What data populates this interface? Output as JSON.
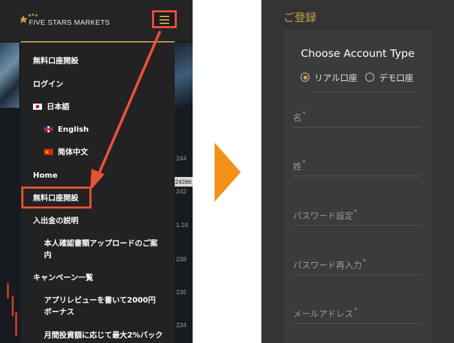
{
  "left": {
    "logo_text": "FIVE STARS MARKETS",
    "menu": [
      {
        "label": "無料口座開設"
      },
      {
        "label": "ログイン"
      },
      {
        "label": "日本語",
        "flag": "jp"
      },
      {
        "label": "English",
        "flag": "uk"
      },
      {
        "label": "简体中文",
        "flag": "cn"
      },
      {
        "label": "Home"
      },
      {
        "label": "無料口座開設",
        "highlighted": true
      },
      {
        "label": "入出金の説明"
      },
      {
        "label": "本人確認書類アップロードのご案内"
      },
      {
        "label": "キャンペーン一覧"
      },
      {
        "label": "アプリレビューを書いて2000円ボーナス"
      },
      {
        "label": "月間投資額に応じて最大2%バック"
      }
    ],
    "axis_labels": [
      "244",
      "24286",
      "242",
      "1.24",
      "238",
      "236",
      "234"
    ]
  },
  "right": {
    "page_title": "ご登録",
    "card_title": "Choose Account Type",
    "account_types": [
      {
        "label": "リアル口座",
        "selected": true
      },
      {
        "label": "デモ口座",
        "selected": false
      }
    ],
    "fields": [
      {
        "label": "名",
        "required_mark": "*"
      },
      {
        "label": "姓",
        "required_mark": "*"
      },
      {
        "label": "パスワード設定",
        "required_mark": "*"
      },
      {
        "label": "パスワード再入力",
        "required_mark": "*"
      },
      {
        "label": "メールアドレス",
        "required_mark": "*"
      }
    ]
  },
  "colors": {
    "accent_gold": "#c8a14a",
    "highlight_red": "#e8503a",
    "arrow_orange": "#f39019",
    "panel_dark": "#262626",
    "form_bg": "#333333",
    "card_bg": "#3b3b3b"
  },
  "icons": [
    "hamburger-menu-icon",
    "five-stars-logo-icon",
    "japan-flag-icon",
    "uk-flag-icon",
    "china-flag-icon",
    "next-step-arrow-icon",
    "radio-icon"
  ]
}
